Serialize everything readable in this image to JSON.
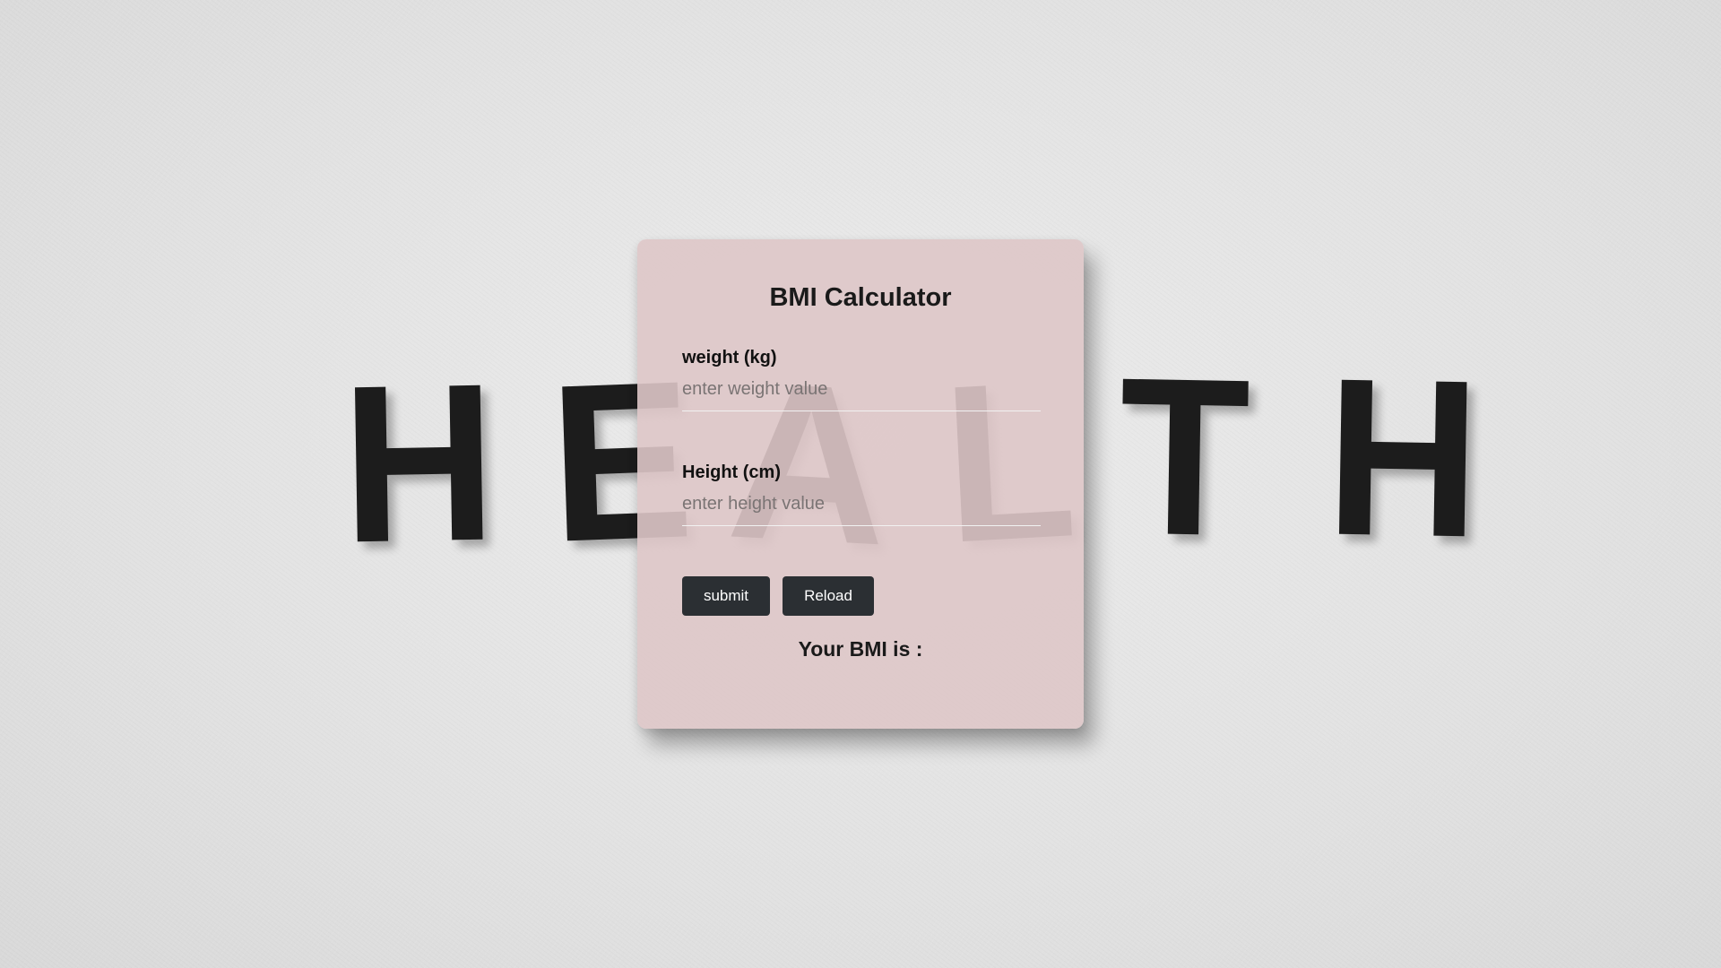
{
  "background": {
    "letters": [
      "H",
      "E",
      "A",
      "L",
      "T",
      "H"
    ]
  },
  "calculator": {
    "title": "BMI Calculator",
    "weight": {
      "label": "weight (kg)",
      "placeholder": "enter weight value",
      "value": ""
    },
    "height": {
      "label": "Height (cm)",
      "placeholder": "enter height value",
      "value": ""
    },
    "buttons": {
      "submit_label": "submit",
      "reload_label": "Reload"
    },
    "result_text": "Your BMI is :"
  },
  "colors": {
    "card_background": "#dec6c8",
    "button_background": "#2b2f33",
    "button_text": "#ffffff"
  }
}
